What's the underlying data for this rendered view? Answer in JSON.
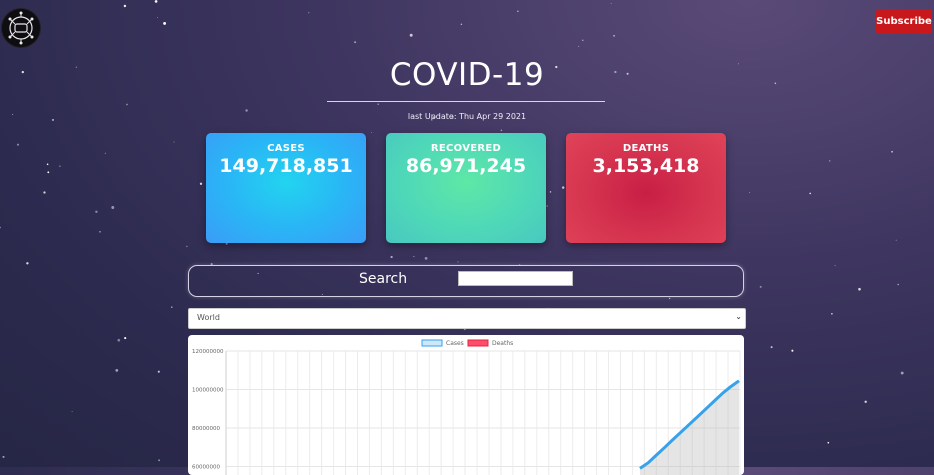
{
  "header": {
    "logo": "circuit-logo",
    "subscribe_label": "Subscribe",
    "subscribe_color": "#c8181c"
  },
  "page": {
    "title": "COVID-19",
    "last_update": "last Update: Thu Apr 29 2021"
  },
  "stats": {
    "cases": {
      "label": "CASES",
      "value": "149,718,851"
    },
    "recovered": {
      "label": "RECOVERED",
      "value": "86,971,245"
    },
    "deaths": {
      "label": "DEATHS",
      "value": "3,153,418"
    }
  },
  "search": {
    "label": "Search",
    "value": "",
    "placeholder": ""
  },
  "country_select": {
    "selected": "World"
  },
  "chart_data": {
    "type": "line",
    "legend": [
      "Cases",
      "Deaths"
    ],
    "legend_placement": "top-center",
    "y_ticks": [
      "120000000",
      "100000000",
      "80000000",
      "60000000"
    ],
    "ylim": [
      60000000,
      120000000
    ],
    "grid": true,
    "series": [
      {
        "name": "Cases",
        "color": "#36a2eb",
        "values": [
          59000000,
          62000000,
          66000000,
          70000000,
          74000000,
          78000000,
          82000000,
          86000000,
          90000000,
          94000000,
          98000000,
          101500000,
          104500000
        ]
      },
      {
        "name": "Deaths",
        "color": "#ff4d6b",
        "values": []
      }
    ]
  }
}
